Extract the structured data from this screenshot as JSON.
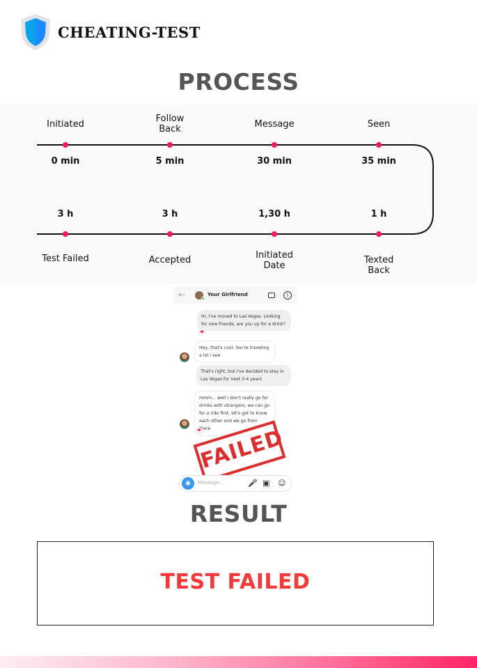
{
  "brand": {
    "name": "CHEATING-TEST",
    "logo_icon": "shield-icon",
    "colors": {
      "shield_left": "#0aa4ec",
      "shield_right": "#1a8cff",
      "shield_border": "#e3e3e6"
    }
  },
  "process": {
    "title": "PROCESS",
    "accent_color": "#f0195c",
    "top_row": [
      {
        "label": "Initiated",
        "time": "0 min"
      },
      {
        "label": "Follow\nBack",
        "time": "5 min"
      },
      {
        "label": "Message",
        "time": "30 min"
      },
      {
        "label": "Seen",
        "time": "35 min"
      }
    ],
    "bottom_row": [
      {
        "label": "Test Failed",
        "time": "3 h"
      },
      {
        "label": "Accepted",
        "time": "3 h"
      },
      {
        "label": "Initiated\nDate",
        "time": "1,30 h"
      },
      {
        "label": "Texted\nBack",
        "time": "1 h"
      }
    ]
  },
  "chat": {
    "contact_name": "Your Girlfriend",
    "messages": [
      {
        "direction": "out",
        "text": "Hi, I've moved to Las Vegas. Looking for new friends, are you up for a drink?",
        "reaction": "❤"
      },
      {
        "direction": "in",
        "text": "Hey, that's cool. You're traveling a lot I see"
      },
      {
        "direction": "out",
        "text": "That's right, but I've decided to stay in Las Vegas for next 3-4 years"
      },
      {
        "direction": "in",
        "text": "mmm... well I don't really go for drinks with strangers, we can go for a ride first, let's get to know each other and we go from there",
        "reaction": "❤"
      }
    ],
    "stamp": "FAILED",
    "composer_placeholder": "Message..."
  },
  "result": {
    "title": "RESULT",
    "status": "TEST FAILED",
    "status_color": "#f23a3a"
  }
}
